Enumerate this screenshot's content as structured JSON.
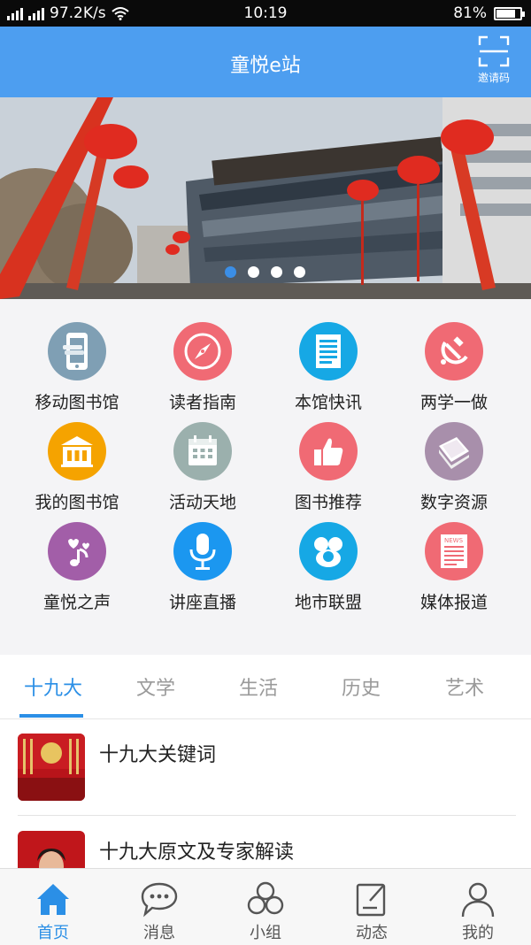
{
  "status_bar": {
    "network": "97.2K/s",
    "time": "10:19",
    "battery": "81%",
    "battery_level": 0.81
  },
  "header": {
    "title": "童悦e站",
    "invite_label": "邀请码"
  },
  "banner": {
    "slide_count": 4,
    "active_index": 0
  },
  "grid": [
    {
      "label": "移动图书馆",
      "icon": "mobile-library-icon",
      "color": "#7f9fb4"
    },
    {
      "label": "读者指南",
      "icon": "compass-icon",
      "color": "#f06a74"
    },
    {
      "label": "本馆快讯",
      "icon": "news-document-icon",
      "color": "#16a8e5"
    },
    {
      "label": "两学一做",
      "icon": "hammer-sickle-icon",
      "color": "#f06a74"
    },
    {
      "label": "我的图书馆",
      "icon": "library-building-icon",
      "color": "#f5a300"
    },
    {
      "label": "活动天地",
      "icon": "calendar-icon",
      "color": "#9bb0ad"
    },
    {
      "label": "图书推荐",
      "icon": "thumbs-up-icon",
      "color": "#f06a74"
    },
    {
      "label": "数字资源",
      "icon": "book-stack-icon",
      "color": "#a88fab"
    },
    {
      "label": "童悦之声",
      "icon": "music-note-icon",
      "color": "#a25ea8"
    },
    {
      "label": "讲座直播",
      "icon": "microphone-icon",
      "color": "#1b97f0"
    },
    {
      "label": "地市联盟",
      "icon": "alliance-people-icon",
      "color": "#16a8e5"
    },
    {
      "label": "媒体报道",
      "icon": "newspaper-icon",
      "color": "#f06a74"
    }
  ],
  "tabs": [
    "十九大",
    "文学",
    "生活",
    "历史",
    "艺术"
  ],
  "active_tab": 0,
  "list": [
    {
      "title": "十九大关键词"
    },
    {
      "title": "十九大原文及专家解读"
    }
  ],
  "bottom_nav": [
    {
      "label": "首页",
      "icon": "home-icon",
      "active": true
    },
    {
      "label": "消息",
      "icon": "chat-bubble-icon",
      "active": false
    },
    {
      "label": "小组",
      "icon": "group-icon",
      "active": false
    },
    {
      "label": "动态",
      "icon": "edit-note-icon",
      "active": false
    },
    {
      "label": "我的",
      "icon": "person-icon",
      "active": false
    }
  ],
  "colors": {
    "accent": "#4d9ef0",
    "tab_active": "#2b8fe6",
    "dot_active": "#3b8ee6"
  }
}
